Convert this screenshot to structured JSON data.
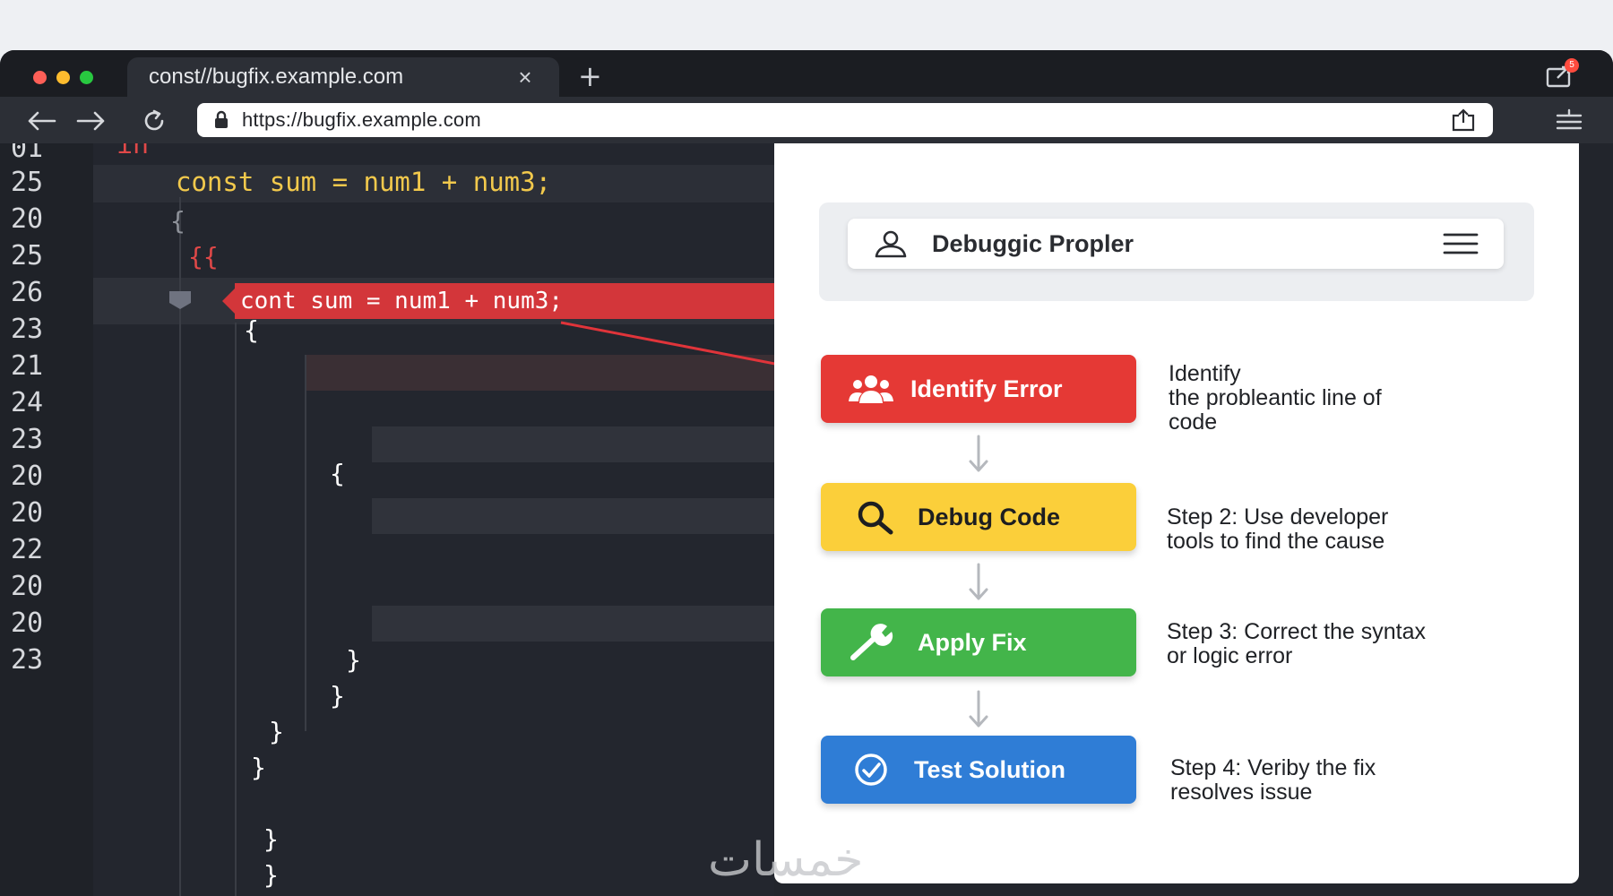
{
  "browser": {
    "tab_title": "const//bugfix.example.com",
    "tab_close": "×",
    "new_tab": "+",
    "ext_badge": "5",
    "url": "https://bugfix.example.com"
  },
  "editor": {
    "line_numbers": [
      "01",
      "25",
      "20",
      "25",
      "26",
      "23",
      "21",
      "24",
      "23",
      "20",
      "20",
      "22",
      "20",
      "20",
      "23"
    ],
    "top_partial": "in",
    "sum_line": "const sum = num1 + num3;",
    "brace_1": "{",
    "brace_2": "{{",
    "error_line": "cont sum = num1 + num3;",
    "brace_3": "{",
    "brace_4": "{",
    "close_1": "}",
    "close_2": "}",
    "close_3": "}",
    "close_4": "}",
    "close_5": "}",
    "close_6": "}"
  },
  "panel": {
    "title": "Debuggic Propler",
    "steps": [
      {
        "label": "Identify Error",
        "description": "Identify\nthe probleantic line of\ncode",
        "color": "#e53935",
        "icon": "users-icon"
      },
      {
        "label": "Debug Code",
        "description": "Step 2: Use developer\ntools to find the cause",
        "color": "#fbcf3a",
        "icon": "search-icon"
      },
      {
        "label": "Apply Fix",
        "description": "Step 3: Correct the syntax\nor logic error",
        "color": "#43b54a",
        "icon": "wrench-icon"
      },
      {
        "label": "Test Solution",
        "description": "Step 4: Veriby the fix\nresolves issue",
        "color": "#2f7dd6",
        "icon": "check-circle-icon"
      }
    ]
  },
  "watermark": "خمسات"
}
